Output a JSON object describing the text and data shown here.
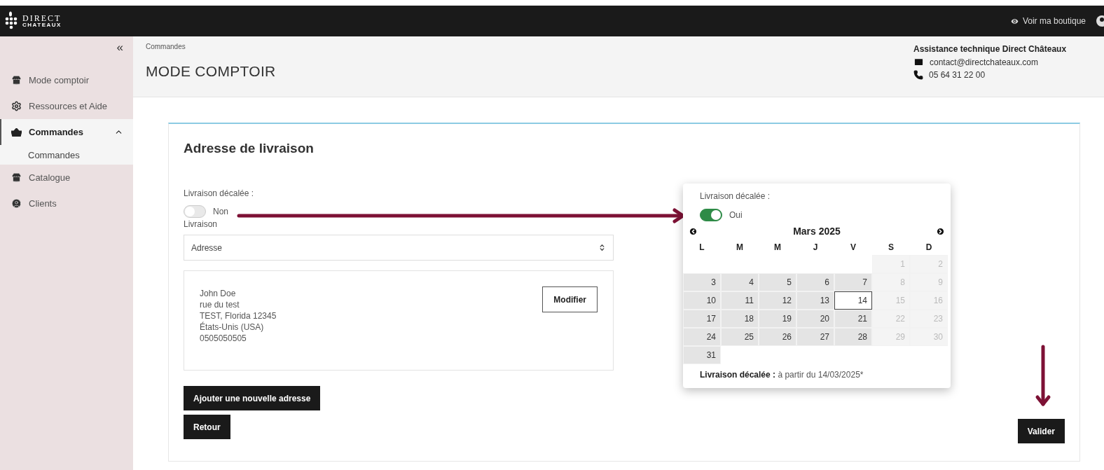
{
  "topbar": {
    "logo_top": "DIRECT",
    "logo_bottom": "CHATEAUX",
    "shop_link": "Voir ma boutique"
  },
  "sidebar": {
    "collapse": "«",
    "items": [
      {
        "label": "Mode comptoir",
        "selected": false
      },
      {
        "label": "Ressources et Aide",
        "selected": false
      },
      {
        "label": "Commandes",
        "selected": true,
        "expanded": true,
        "children": [
          {
            "label": "Commandes",
            "selected": true
          }
        ]
      },
      {
        "label": "Catalogue",
        "selected": false
      },
      {
        "label": "Clients",
        "selected": false
      }
    ]
  },
  "header": {
    "breadcrumb": "Commandes",
    "title": "MODE COMPTOIR",
    "support": {
      "title": "Assistance technique Direct Châteaux",
      "email": "contact@directchateaux.com",
      "phone": "05 64 31 22 00"
    }
  },
  "card": {
    "title": "Adresse de livraison",
    "delayed_toggle": {
      "label": "Livraison décalée :",
      "on": false,
      "text": "Non"
    },
    "delivery_label": "Livraison",
    "delivery_select": {
      "value": "Adresse"
    },
    "address": {
      "lines": [
        "John Doe",
        "rue du test",
        "TEST, Florida 12345",
        "États-Unis (USA)",
        "0505050505"
      ],
      "edit_button": "Modifier"
    },
    "buttons": [
      "Ajouter une nouvelle adresse",
      "Retour"
    ],
    "submit": "Valider"
  },
  "overlay": {
    "delayed_toggle": {
      "label": "Livraison décalée :",
      "on": true,
      "text": "Oui"
    },
    "calendar": {
      "month": "Mars 2025",
      "weekdays": [
        "L",
        "M",
        "M",
        "J",
        "V",
        "S",
        "D"
      ],
      "weeks": [
        [
          {
            "kind": "blank"
          },
          {
            "kind": "blank"
          },
          {
            "kind": "blank"
          },
          {
            "kind": "blank"
          },
          {
            "kind": "blank"
          },
          {
            "day": "1",
            "disabled": true,
            "selected": false
          },
          {
            "day": "2",
            "disabled": true,
            "selected": false
          }
        ],
        [
          {
            "day": "3",
            "disabled": false,
            "selected": false
          },
          {
            "day": "4",
            "disabled": false,
            "selected": false
          },
          {
            "day": "5",
            "disabled": false,
            "selected": false
          },
          {
            "day": "6",
            "disabled": false,
            "selected": false
          },
          {
            "day": "7",
            "disabled": false,
            "selected": false
          },
          {
            "day": "8",
            "disabled": true,
            "selected": false
          },
          {
            "day": "9",
            "disabled": true,
            "selected": false
          }
        ],
        [
          {
            "day": "10",
            "disabled": false,
            "selected": false
          },
          {
            "day": "11",
            "disabled": false,
            "selected": false
          },
          {
            "day": "12",
            "disabled": false,
            "selected": false
          },
          {
            "day": "13",
            "disabled": false,
            "selected": false
          },
          {
            "day": "14",
            "disabled": false,
            "selected": true
          },
          {
            "day": "15",
            "disabled": true,
            "selected": false
          },
          {
            "day": "16",
            "disabled": true,
            "selected": false
          }
        ],
        [
          {
            "day": "17",
            "disabled": false,
            "selected": false
          },
          {
            "day": "18",
            "disabled": false,
            "selected": false
          },
          {
            "day": "19",
            "disabled": false,
            "selected": false
          },
          {
            "day": "20",
            "disabled": false,
            "selected": false
          },
          {
            "day": "21",
            "disabled": false,
            "selected": false
          },
          {
            "day": "22",
            "disabled": true,
            "selected": false
          },
          {
            "day": "23",
            "disabled": true,
            "selected": false
          }
        ],
        [
          {
            "day": "24",
            "disabled": false,
            "selected": false
          },
          {
            "day": "25",
            "disabled": false,
            "selected": false
          },
          {
            "day": "26",
            "disabled": false,
            "selected": false
          },
          {
            "day": "27",
            "disabled": false,
            "selected": false
          },
          {
            "day": "28",
            "disabled": false,
            "selected": false
          },
          {
            "day": "29",
            "disabled": true,
            "selected": false
          },
          {
            "day": "30",
            "disabled": true,
            "selected": false
          }
        ],
        [
          {
            "day": "31",
            "disabled": false,
            "selected": false
          },
          {
            "kind": "blank"
          },
          {
            "kind": "blank"
          },
          {
            "kind": "blank"
          },
          {
            "kind": "blank"
          },
          {
            "kind": "blank"
          },
          {
            "kind": "blank"
          }
        ]
      ]
    },
    "note": "**Livraison décalée :** à partir du 14/03/2025*"
  }
}
